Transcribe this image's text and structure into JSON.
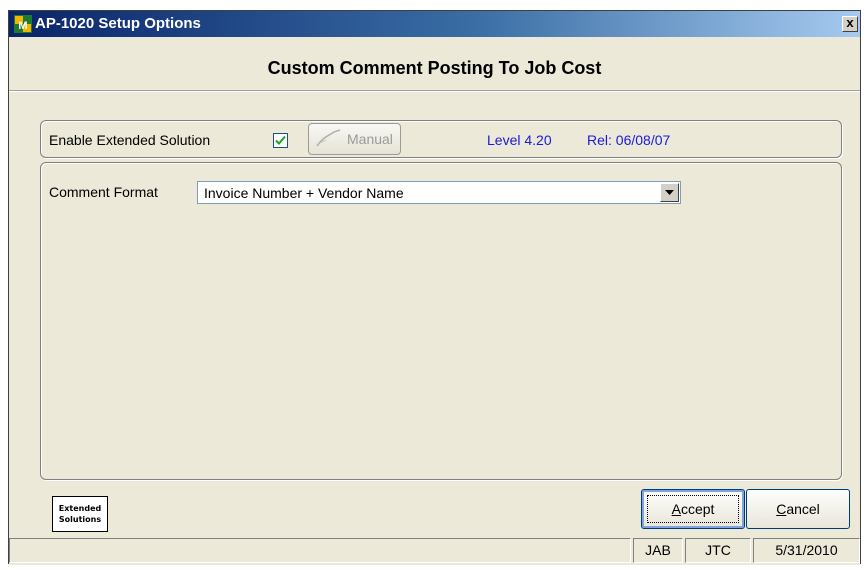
{
  "window": {
    "title": "AP-1020  Setup Options",
    "close_label": "x"
  },
  "heading": "Custom Comment Posting To Job Cost",
  "enable": {
    "label": "Enable Extended Solution",
    "checked": true,
    "manual_label": "Manual",
    "level": "Level 4.20",
    "release": "Rel: 06/08/07"
  },
  "comment_format": {
    "label": "Comment Format",
    "value": "Invoice Number + Vendor Name"
  },
  "logo": {
    "line1": "Extended",
    "line2": "Solutions"
  },
  "buttons": {
    "accept_underline": "A",
    "accept_rest": "ccept",
    "cancel_underline": "C",
    "cancel_rest": "ancel"
  },
  "statusbar": {
    "user": "JAB",
    "company": "JTC",
    "date": "5/31/2010"
  },
  "colors": {
    "accent_blue": "#1a1ad8",
    "title_gradient_start": "#0a246a",
    "dialog_bg": "#ece9d8"
  }
}
